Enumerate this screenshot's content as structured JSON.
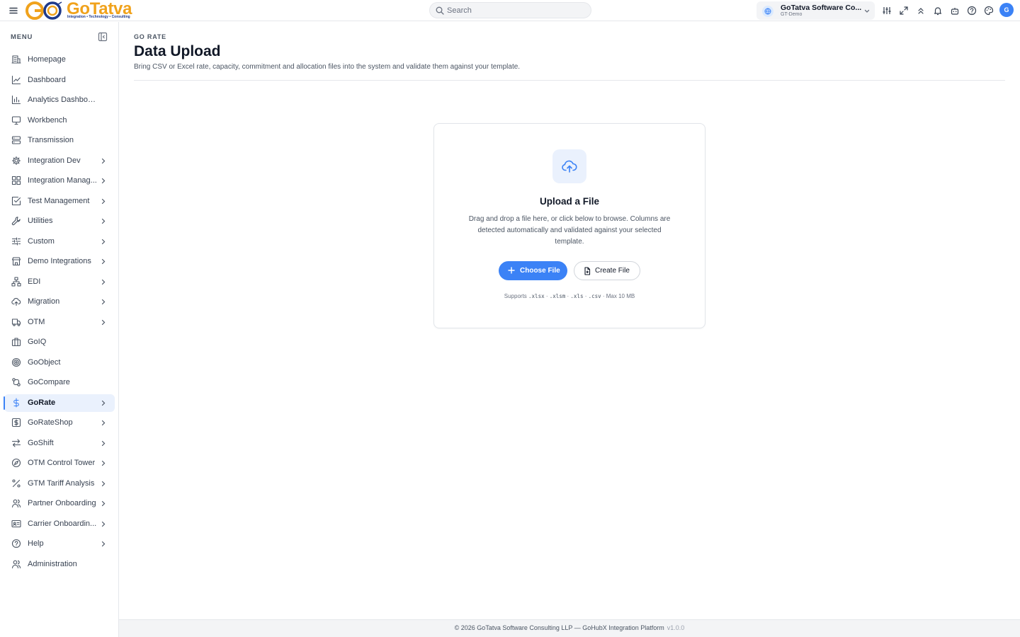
{
  "app": {
    "logo_word": "GoTatva",
    "logo_tagline": "Integration • Technology • Consulting"
  },
  "search": {
    "placeholder": "Search"
  },
  "org": {
    "name": "GoTatva Software Co...",
    "sub": "GT-Demo"
  },
  "user": {
    "initial": "G"
  },
  "sidebar": {
    "menu_label": "MENU",
    "items": [
      {
        "label": "Homepage",
        "icon": "building-icon",
        "chevron": false
      },
      {
        "label": "Dashboard",
        "icon": "line-chart-icon",
        "chevron": false
      },
      {
        "label": "Analytics Dashboard",
        "icon": "bar-chart-icon",
        "chevron": false
      },
      {
        "label": "Workbench",
        "icon": "monitor-icon",
        "chevron": false
      },
      {
        "label": "Transmission",
        "icon": "server-icon",
        "chevron": false
      },
      {
        "label": "Integration Dev",
        "icon": "gear-icon",
        "chevron": true
      },
      {
        "label": "Integration Manag...",
        "icon": "grid-icon",
        "chevron": true
      },
      {
        "label": "Test Management",
        "icon": "checkbox-icon",
        "chevron": true
      },
      {
        "label": "Utilities",
        "icon": "wrench-icon",
        "chevron": true
      },
      {
        "label": "Custom",
        "icon": "sliders-icon",
        "chevron": true
      },
      {
        "label": "Demo Integrations",
        "icon": "store-icon",
        "chevron": true
      },
      {
        "label": "EDI",
        "icon": "network-icon",
        "chevron": true
      },
      {
        "label": "Migration",
        "icon": "cloud-upload-icon",
        "chevron": true
      },
      {
        "label": "OTM",
        "icon": "truck-icon",
        "chevron": true
      },
      {
        "label": "GoIQ",
        "icon": "briefcase-icon",
        "chevron": false
      },
      {
        "label": "GoObject",
        "icon": "target-icon",
        "chevron": false
      },
      {
        "label": "GoCompare",
        "icon": "compare-icon",
        "chevron": false
      },
      {
        "label": "GoRate",
        "icon": "dollar-icon",
        "chevron": true,
        "active": true
      },
      {
        "label": "GoRateShop",
        "icon": "dollar-square-icon",
        "chevron": true
      },
      {
        "label": "GoShift",
        "icon": "swap-icon",
        "chevron": true
      },
      {
        "label": "OTM Control Tower",
        "icon": "compass-icon",
        "chevron": true
      },
      {
        "label": "GTM Tariff Analysis",
        "icon": "percent-icon",
        "chevron": true
      },
      {
        "label": "Partner Onboarding",
        "icon": "users-icon",
        "chevron": true
      },
      {
        "label": "Carrier Onboardin...",
        "icon": "id-card-icon",
        "chevron": true
      },
      {
        "label": "Help",
        "icon": "help-circle-icon",
        "chevron": true
      },
      {
        "label": "Administration",
        "icon": "user-group-icon",
        "chevron": false
      }
    ]
  },
  "page": {
    "eyebrow": "GO RATE",
    "title": "Data Upload",
    "description": "Bring CSV or Excel rate, capacity, commitment and allocation files into the system and validate them against your template."
  },
  "upload": {
    "title": "Upload a File",
    "description": "Drag and drop a file here, or click below to browse. Columns are detected automatically and validated against your selected template.",
    "choose_label": "Choose File",
    "create_label": "Create File",
    "supports_prefix": "Supports",
    "formats": [
      ".xlsx",
      ".xlsm",
      ".xls",
      ".csv"
    ],
    "max_size": "Max 10 MB"
  },
  "footer": {
    "text": "© 2026 GoTatva Software Consulting LLP — GoHubX Integration Platform",
    "version": "v1.0.0"
  },
  "colors": {
    "accent": "#3b82f6",
    "brand_orange": "#f0a21c",
    "brand_navy": "#1f3a8a"
  }
}
